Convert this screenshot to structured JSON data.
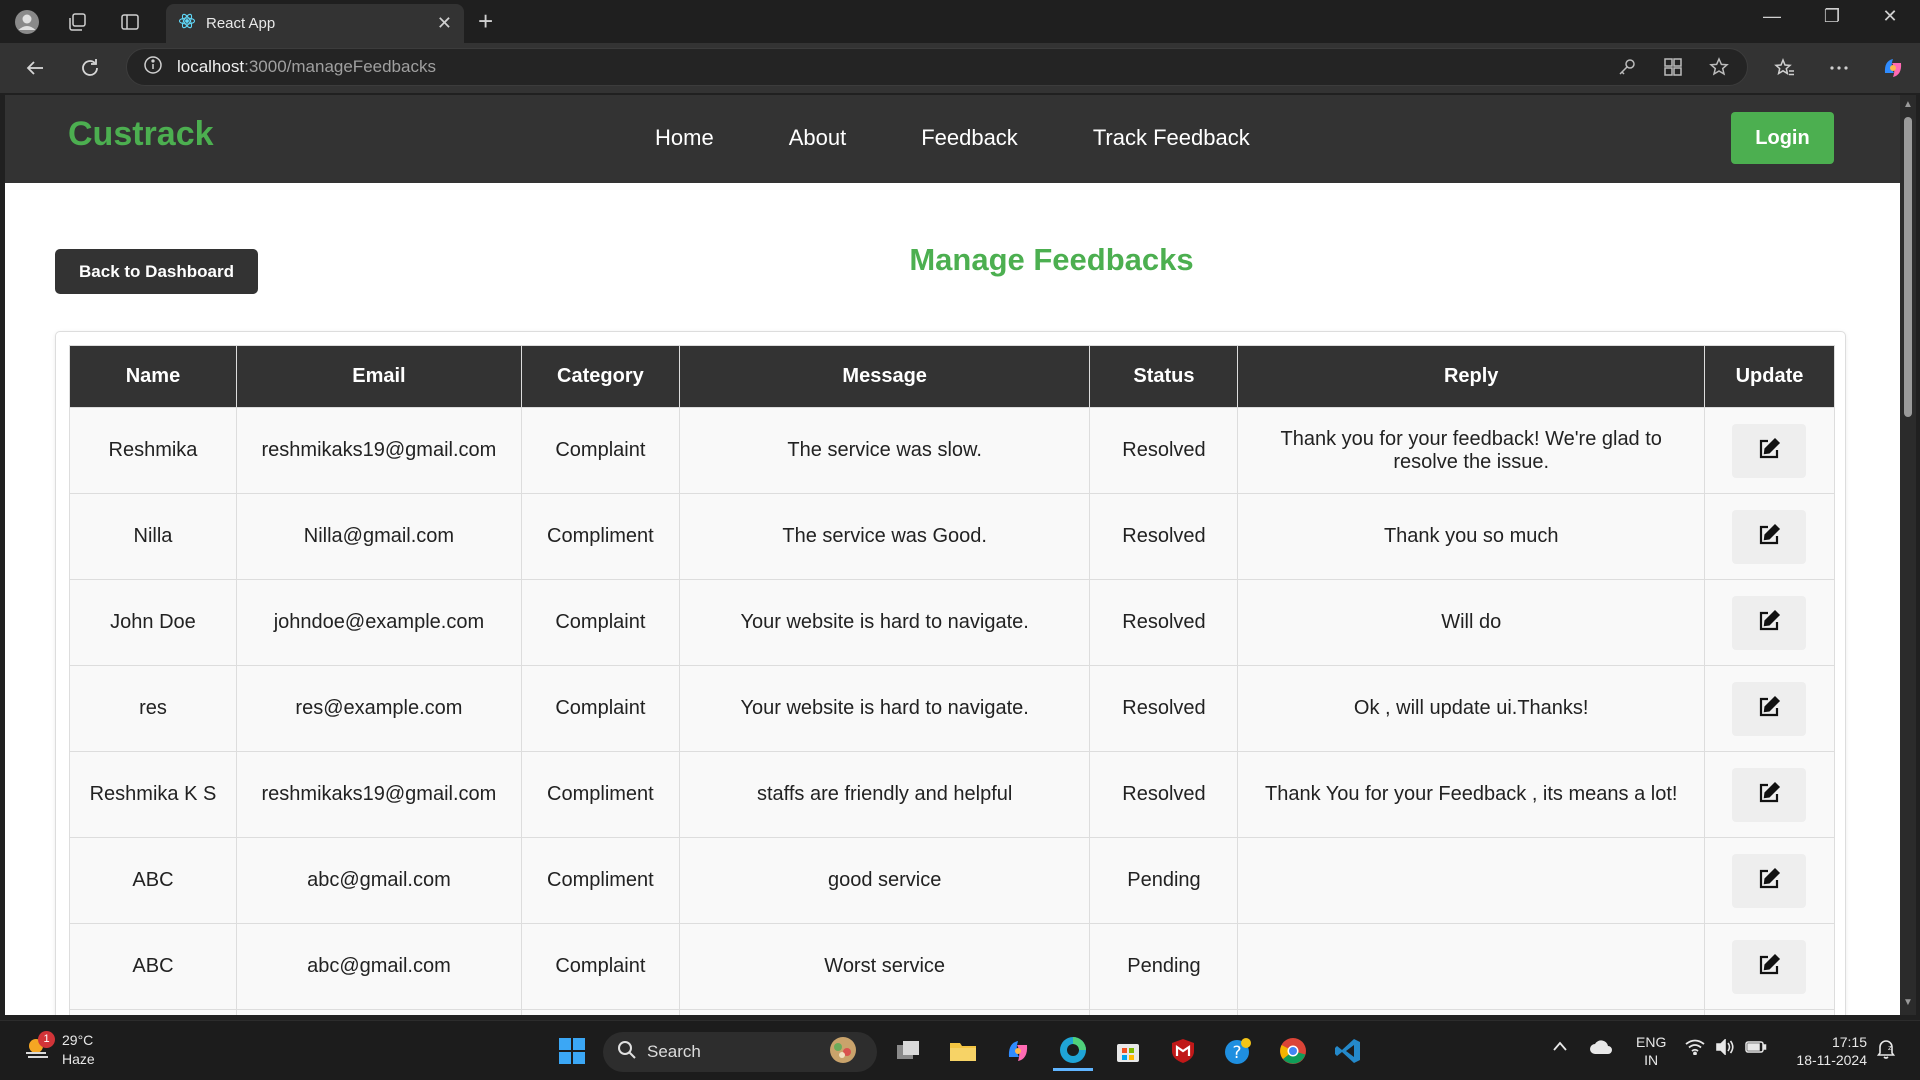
{
  "browser": {
    "tab_title": "React App",
    "url_host": "localhost",
    "url_rest": ":3000/manageFeedbacks"
  },
  "app": {
    "brand": "Custrack",
    "nav": [
      "Home",
      "About",
      "Feedback",
      "Track Feedback"
    ],
    "login_label": "Login",
    "back_label": "Back to Dashboard",
    "page_title": "Manage Feedbacks",
    "accent_color": "#4caf50"
  },
  "table": {
    "headers": [
      "Name",
      "Email",
      "Category",
      "Message",
      "Status",
      "Reply",
      "Update"
    ],
    "rows": [
      {
        "name": "Reshmika",
        "email": "reshmikaks19@gmail.com",
        "category": "Complaint",
        "message": "The service was slow.",
        "status": "Resolved",
        "reply": "Thank you for your feedback! We're glad to resolve the issue."
      },
      {
        "name": "Nilla",
        "email": "Nilla@gmail.com",
        "category": "Compliment",
        "message": "The service was Good.",
        "status": "Resolved",
        "reply": "Thank you so much"
      },
      {
        "name": "John Doe",
        "email": "johndoe@example.com",
        "category": "Complaint",
        "message": "Your website is hard to navigate.",
        "status": "Resolved",
        "reply": "Will do"
      },
      {
        "name": "res",
        "email": "res@example.com",
        "category": "Complaint",
        "message": "Your website is hard to navigate.",
        "status": "Resolved",
        "reply": "Ok , will update ui.Thanks!"
      },
      {
        "name": "Reshmika K S",
        "email": "reshmikaks19@gmail.com",
        "category": "Compliment",
        "message": "staffs are friendly and helpful",
        "status": "Resolved",
        "reply": "Thank You for your Feedback , its means a lot!"
      },
      {
        "name": "ABC",
        "email": "abc@gmail.com",
        "category": "Compliment",
        "message": "good service",
        "status": "Pending",
        "reply": ""
      },
      {
        "name": "ABC",
        "email": "abc@gmail.com",
        "category": "Complaint",
        "message": "Worst service",
        "status": "Pending",
        "reply": ""
      }
    ]
  },
  "taskbar": {
    "weather_temp": "29°C",
    "weather_desc": "Haze",
    "weather_badge": "1",
    "search_label": "Search",
    "lang_top": "ENG",
    "lang_bottom": "IN",
    "time": "17:15",
    "date": "18-11-2024"
  }
}
